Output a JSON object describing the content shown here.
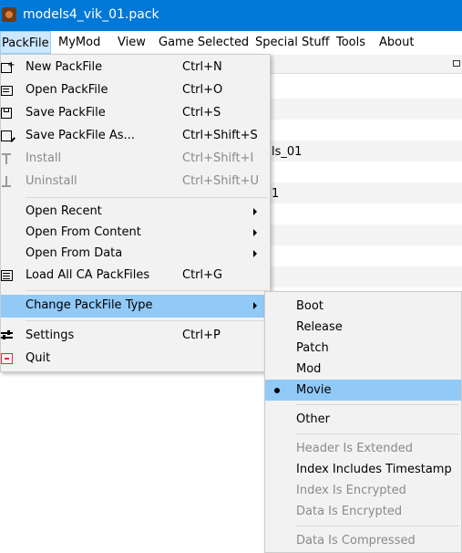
{
  "window": {
    "title": "models4_vik_01.pack"
  },
  "menubar": [
    "PackFile",
    "MyMod",
    "View",
    "Game Selected",
    "Special Stuff",
    "Tools",
    "About"
  ],
  "background_rows": [
    "ls_01",
    "1"
  ],
  "packfile_menu": {
    "new": {
      "label": "New PackFile",
      "shortcut": "Ctrl+N"
    },
    "open": {
      "label": "Open PackFile",
      "shortcut": "Ctrl+O"
    },
    "save": {
      "label": "Save PackFile",
      "shortcut": "Ctrl+S"
    },
    "save_as": {
      "label": "Save PackFile As...",
      "shortcut": "Ctrl+Shift+S"
    },
    "install": {
      "label": "Install",
      "shortcut": "Ctrl+Shift+I"
    },
    "uninstall": {
      "label": "Uninstall",
      "shortcut": "Ctrl+Shift+U"
    },
    "open_recent": {
      "label": "Open Recent"
    },
    "open_from_content": {
      "label": "Open From Content"
    },
    "open_from_data": {
      "label": "Open From Data"
    },
    "load_all": {
      "label": "Load All CA PackFiles",
      "shortcut": "Ctrl+G"
    },
    "change_type": {
      "label": "Change PackFile Type"
    },
    "settings": {
      "label": "Settings",
      "shortcut": "Ctrl+P"
    },
    "quit": {
      "label": "Quit"
    }
  },
  "packfile_type_submenu": {
    "boot": "Boot",
    "release": "Release",
    "patch": "Patch",
    "mod": "Mod",
    "movie": "Movie",
    "other": "Other",
    "header_extended": "Header Is Extended",
    "index_timestamp": "Index Includes Timestamp",
    "index_encrypted": "Index Is Encrypted",
    "data_encrypted": "Data Is Encrypted",
    "data_compressed": "Data Is Compressed",
    "selected": "Movie"
  },
  "colors": {
    "titlebar": "#0078d7",
    "highlight": "#91c9f7",
    "menu_bg": "#f2f2f2",
    "disabled_text": "#8a8a8a"
  }
}
